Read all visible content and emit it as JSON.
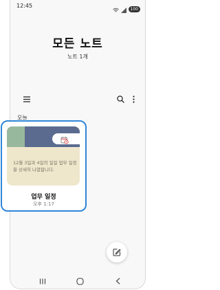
{
  "status_bar": {
    "time": "12:45",
    "battery": "100"
  },
  "header": {
    "title": "모든 노트",
    "count": "노트 1개"
  },
  "section": {
    "label": "오늘"
  },
  "note": {
    "thumbnail_text": "12월 3일과 4일의 일일 업무 일정을 상세히 나열합니다.",
    "title": "업무 일정",
    "time": "오후 1:17"
  },
  "colors": {
    "accent": "#2f86d8",
    "thumb_header": "#5a6b8f",
    "thumb_green": "#98b89e",
    "thumb_body": "#efe7cc"
  }
}
